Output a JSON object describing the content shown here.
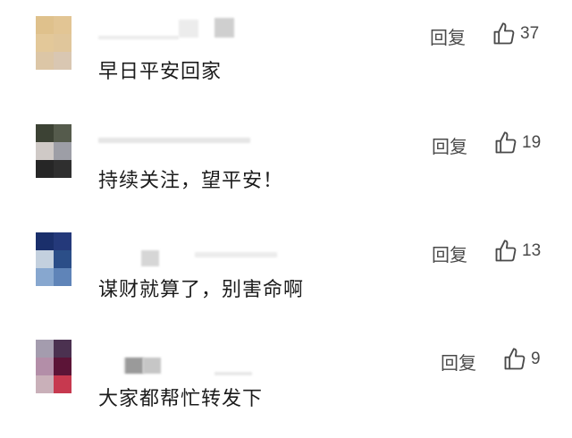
{
  "comments": [
    {
      "text": "早日平安回家",
      "reply_label": "回复",
      "likes": "37",
      "avatar_colors": [
        "#dfc18c",
        "#e2c594",
        "#e3c899",
        "#e0c69b",
        "#dcc6a6",
        "#d9c7b2"
      ]
    },
    {
      "text": "持续关注，望平安！",
      "reply_label": "回复",
      "likes": "19",
      "avatar_colors": [
        "#3c4234",
        "#555b4c",
        "#cfc9c6",
        "#9d9ea6",
        "#262626",
        "#2f2f2f"
      ]
    },
    {
      "text": "谋财就算了，别害命啊",
      "reply_label": "回复",
      "likes": "13",
      "avatar_colors": [
        "#1a2f6b",
        "#24397a",
        "#c3d0de",
        "#2b4e88",
        "#87a7cf",
        "#5f84b8"
      ]
    },
    {
      "text": "大家都帮忙转发下",
      "reply_label": "回复",
      "likes": "9",
      "avatar_colors": [
        "#a49cae",
        "#4b3150",
        "#b38ea8",
        "#5c1437",
        "#c9b0b9",
        "#c7394f"
      ]
    }
  ],
  "icons": {
    "like": "thumbs-up-icon"
  },
  "colors": {
    "text": "#1c1c1c",
    "meta": "#4a4a4a",
    "name_blur": "#d2d2d2"
  }
}
